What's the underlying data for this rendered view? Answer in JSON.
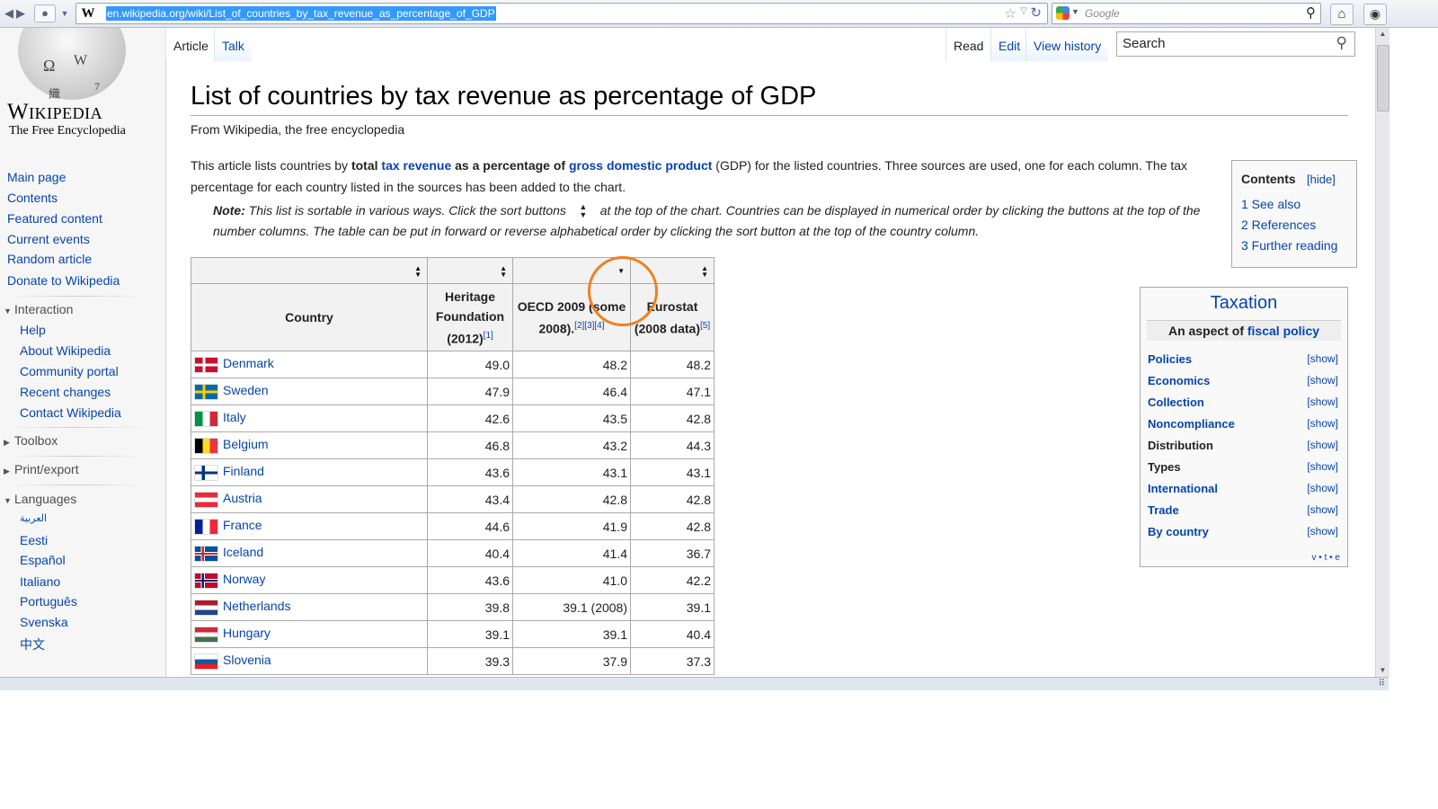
{
  "browser": {
    "url": "en.wikipedia.org/wiki/List_of_countries_by_tax_revenue_as_percentage_of_GDP",
    "favicon": "W",
    "search_placeholder": "Google",
    "icons": [
      "back-arrow-icon",
      "forward-arrow-icon",
      "page-info-icon",
      "star-icon",
      "reload-icon",
      "google-icon",
      "magnifier-icon",
      "home-icon",
      "addon-icon"
    ]
  },
  "sidebar": {
    "logo_word": "Wikipedia",
    "logo_tagline": "The Free Encyclopedia",
    "main": [
      {
        "label": "Main page"
      },
      {
        "label": "Contents"
      },
      {
        "label": "Featured content"
      },
      {
        "label": "Current events"
      },
      {
        "label": "Random article"
      },
      {
        "label": "Donate to Wikipedia"
      }
    ],
    "interaction_heading": "Interaction",
    "interaction": [
      {
        "label": "Help"
      },
      {
        "label": "About Wikipedia"
      },
      {
        "label": "Community portal"
      },
      {
        "label": "Recent changes"
      },
      {
        "label": "Contact Wikipedia"
      }
    ],
    "toolbox_heading": "Toolbox",
    "print_heading": "Print/export",
    "languages_heading": "Languages",
    "languages": [
      {
        "label": "العربية"
      },
      {
        "label": "Eesti"
      },
      {
        "label": "Español"
      },
      {
        "label": "Italiano"
      },
      {
        "label": "Português"
      },
      {
        "label": "Svenska"
      },
      {
        "label": "中文"
      }
    ]
  },
  "tabs": {
    "article": "Article",
    "talk": "Talk",
    "read": "Read",
    "edit": "Edit",
    "history": "View history",
    "search_placeholder": "Search"
  },
  "article": {
    "title": "List of countries by tax revenue as percentage of GDP",
    "tagline": "From Wikipedia, the free encyclopedia",
    "intro_1": "This article lists countries by ",
    "intro_bold_1": "total",
    "intro_link_1": "tax revenue",
    "intro_bold_2": " as a percentage of ",
    "intro_link_2": "gross domestic product",
    "intro_2": " (GDP) for the listed countries. Three sources are used, one for each column. The tax percentage for each country listed in the sources has been added to the chart.",
    "note_label": "Note:",
    "note_1": " This list is sortable in various ways. Click the sort buttons ",
    "note_2": " at the top of the chart. Countries can be displayed in numerical order by clicking the buttons at the top of the number columns. The table can be put in forward or reverse alphabetical order by clicking the sort button at the top of the country column."
  },
  "table": {
    "headers": {
      "country": "Country",
      "heritage": "Heritage Foundation (2012)",
      "heritage_ref": "[1]",
      "oecd": "OECD 2009 (some 2008).",
      "oecd_ref": "[2][3][4]",
      "eurostat": "Eurostat (2008 data)",
      "eurostat_ref": "[5]"
    },
    "rows": [
      {
        "country": "Denmark",
        "flag": "denmark",
        "heritage": "49.0",
        "oecd": "48.2",
        "eurostat": "48.2"
      },
      {
        "country": "Sweden",
        "flag": "sweden",
        "heritage": "47.9",
        "oecd": "46.4",
        "eurostat": "47.1"
      },
      {
        "country": "Italy",
        "flag": "italy",
        "heritage": "42.6",
        "oecd": "43.5",
        "eurostat": "42.8"
      },
      {
        "country": "Belgium",
        "flag": "belgium",
        "heritage": "46.8",
        "oecd": "43.2",
        "eurostat": "44.3"
      },
      {
        "country": "Finland",
        "flag": "finland",
        "heritage": "43.6",
        "oecd": "43.1",
        "eurostat": "43.1"
      },
      {
        "country": "Austria",
        "flag": "austria",
        "heritage": "43.4",
        "oecd": "42.8",
        "eurostat": "42.8"
      },
      {
        "country": "France",
        "flag": "france",
        "heritage": "44.6",
        "oecd": "41.9",
        "eurostat": "42.8"
      },
      {
        "country": "Iceland",
        "flag": "iceland",
        "heritage": "40.4",
        "oecd": "41.4",
        "eurostat": "36.7"
      },
      {
        "country": "Norway",
        "flag": "norway",
        "heritage": "43.6",
        "oecd": "41.0",
        "eurostat": "42.2"
      },
      {
        "country": "Netherlands",
        "flag": "netherlands",
        "heritage": "39.8",
        "oecd": "39.1 (2008)",
        "eurostat": "39.1"
      },
      {
        "country": "Hungary",
        "flag": "hungary",
        "heritage": "39.1",
        "oecd": "39.1",
        "eurostat": "40.4"
      },
      {
        "country": "Slovenia",
        "flag": "slovenia",
        "heritage": "39.3",
        "oecd": "37.9",
        "eurostat": "37.3"
      }
    ]
  },
  "toc": {
    "title": "Contents",
    "hide": "[hide]",
    "items": [
      {
        "label": "1 See also"
      },
      {
        "label": "2 References"
      },
      {
        "label": "3 Further reading"
      }
    ]
  },
  "navbox": {
    "title": "Taxation",
    "subtitle_text": "An aspect of ",
    "subtitle_link": "fiscal policy",
    "show": "[show]",
    "rows": [
      {
        "label": "Policies",
        "link": true
      },
      {
        "label": "Economics",
        "link": true
      },
      {
        "label": "Collection",
        "link": true
      },
      {
        "label": "Noncompliance",
        "link": true
      },
      {
        "label": "Distribution",
        "link": false
      },
      {
        "label": "Types",
        "link": false
      },
      {
        "label": "International",
        "link": true
      },
      {
        "label": "Trade",
        "link": true
      },
      {
        "label": "By country",
        "link": true
      }
    ],
    "vte": "v • t • e"
  },
  "colors": {
    "link": "#0645ad",
    "annotation_circle": "#f07f20",
    "url_highlight": "#3399ff"
  }
}
